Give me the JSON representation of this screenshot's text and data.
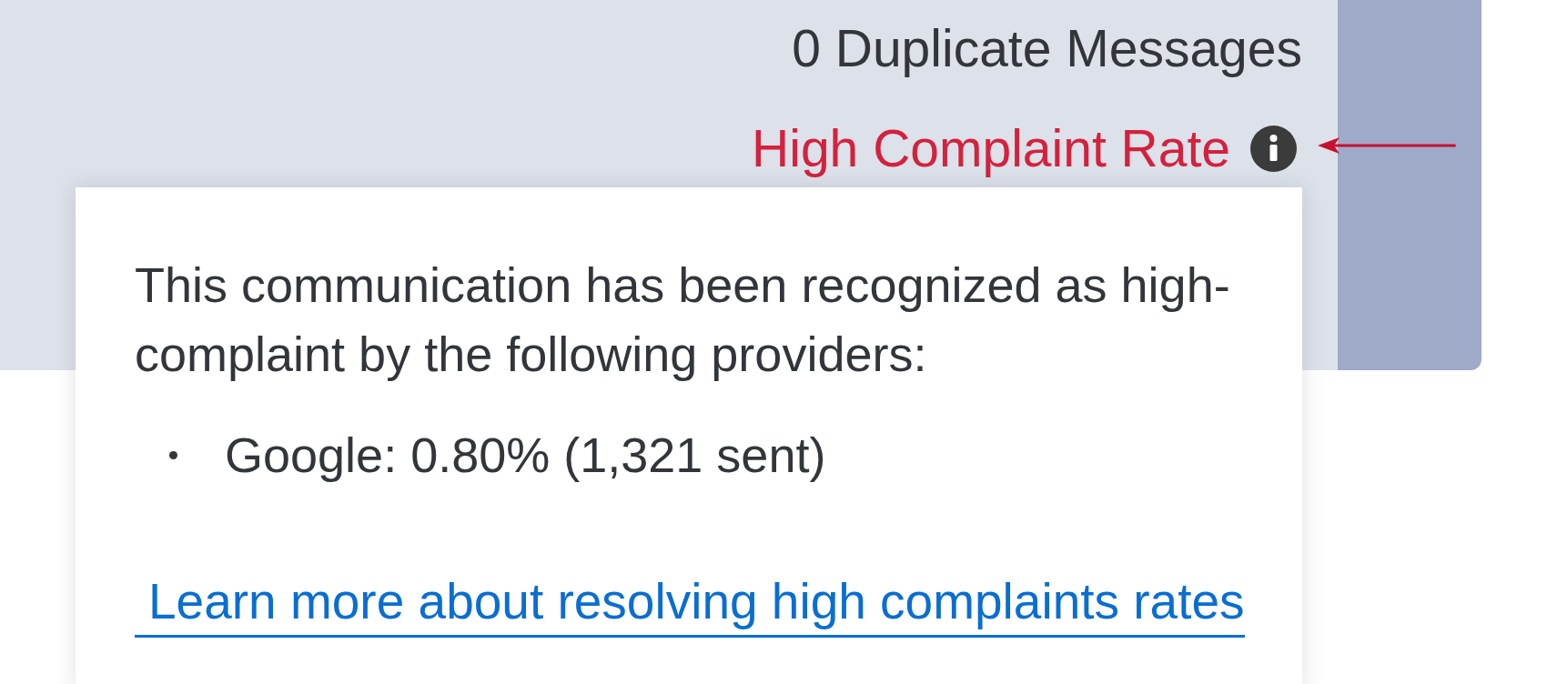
{
  "summary": {
    "duplicates": "0 Duplicate Messages",
    "warning": {
      "text": "High Complaint Rate",
      "alert": true
    }
  },
  "popover": {
    "message": "This communication has been recognized as high-complaint by the following providers:",
    "providers": [
      "Google: 0.80% (1,321 sent)"
    ],
    "link": "Learn more about resolving high complaints rates"
  }
}
